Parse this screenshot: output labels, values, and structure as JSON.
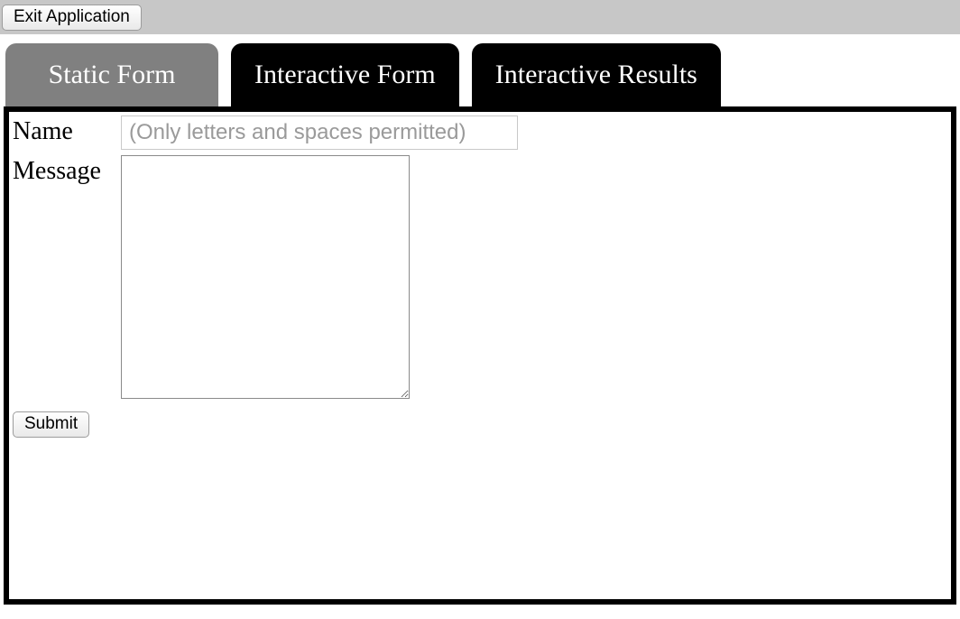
{
  "topbar": {
    "exit_label": "Exit Application"
  },
  "tabs": [
    {
      "label": "Static Form",
      "active": true
    },
    {
      "label": "Interactive Form",
      "active": false
    },
    {
      "label": "Interactive Results",
      "active": false
    }
  ],
  "form": {
    "name_label": "Name",
    "name_value": "",
    "name_placeholder": "(Only letters and spaces permitted)",
    "message_label": "Message",
    "message_value": "",
    "submit_label": "Submit"
  }
}
